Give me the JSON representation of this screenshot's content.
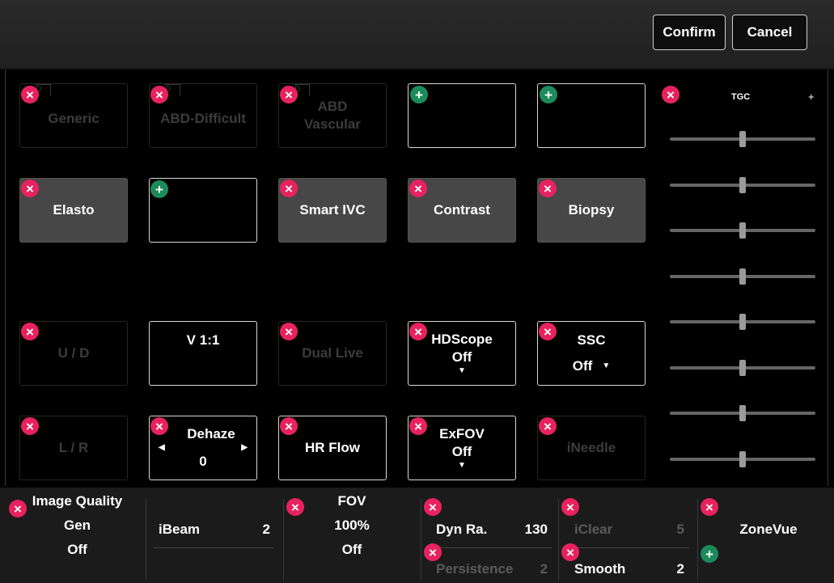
{
  "header": {
    "confirm_label": "Confirm",
    "cancel_label": "Cancel"
  },
  "presets": [
    {
      "label": "Generic"
    },
    {
      "label": "ABD-Difficult"
    },
    {
      "label": "ABD\nVascular"
    }
  ],
  "tiles": {
    "elasto": "Elasto",
    "smart_ivc": "Smart IVC",
    "contrast": "Contrast",
    "biopsy": "Biopsy",
    "ud": "U / D",
    "v11": "V 1:1",
    "dual_live": "Dual Live",
    "hdscope_label": "HDScope",
    "hdscope_value": "Off",
    "ssc_label": "SSC",
    "ssc_value": "Off",
    "lr": "L / R",
    "dehaze_label": "Dehaze",
    "dehaze_value": "0",
    "hr_flow": "HR Flow",
    "exfov_label": "ExFOV",
    "exfov_value": "Off",
    "ineedle": "iNeedle"
  },
  "tgc": {
    "label": "TGC",
    "plus": "+",
    "levels": [
      0.5,
      0.5,
      0.5,
      0.5,
      0.5,
      0.5,
      0.5,
      0.5
    ]
  },
  "bottom": {
    "image_quality_label": "Image Quality",
    "image_quality_value": "Gen",
    "image_quality_state": "Off",
    "ibeam_label": "iBeam",
    "ibeam_value": "2",
    "fov_label": "FOV",
    "fov_value": "100%",
    "fov_state": "Off",
    "dynra_label": "Dyn Ra.",
    "dynra_value": "130",
    "persistence_label": "Persistence",
    "persistence_value": "2",
    "iclear_label": "iClear",
    "iclear_value": "5",
    "smooth_label": "Smooth",
    "smooth_value": "2",
    "zonevue_label": "ZoneVue"
  },
  "icons": {
    "remove": "close-icon",
    "add": "plus-icon",
    "caret": "caret-down-icon"
  },
  "colors": {
    "remove_badge": "#e8225f",
    "add_badge": "#1b8b5b",
    "filled_tile": "#474747"
  }
}
